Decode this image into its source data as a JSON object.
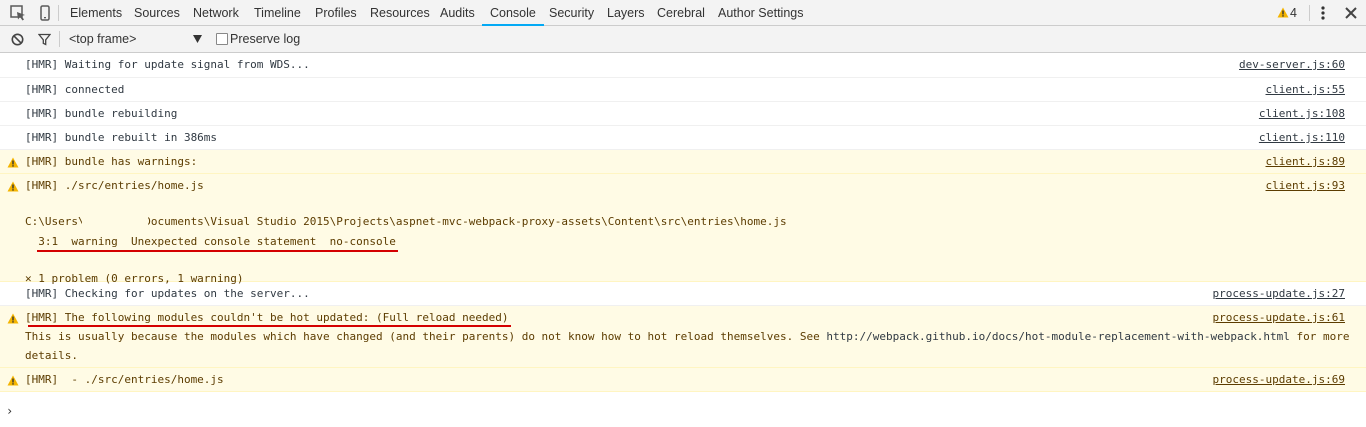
{
  "tabs": [
    "Elements",
    "Sources",
    "Network",
    "Timeline",
    "Profiles",
    "Resources",
    "Audits",
    "Console",
    "Security",
    "Layers",
    "Cerebral",
    "Author Settings"
  ],
  "active_tab": "Console",
  "warning_count": "4",
  "toolbar": {
    "frame": "<top frame>",
    "preserve_log": "Preserve log"
  },
  "messages": {
    "m1": {
      "text": "[HMR] Waiting for update signal from WDS...",
      "src": "dev-server.js:60"
    },
    "m2": {
      "text": "[HMR] connected",
      "src": "client.js:55"
    },
    "m3": {
      "text": "[HMR] bundle rebuilding",
      "src": "client.js:108"
    },
    "m4": {
      "text": "[HMR] bundle rebuilt in 386ms",
      "src": "client.js:110"
    },
    "m5": {
      "text": "[HMR] bundle has warnings:",
      "src": "client.js:89"
    },
    "m6": {
      "text": "[HMR] ./src/entries/home.js",
      "src": "client.js:93",
      "path": "C:\\Users\\        \\Documents\\Visual Studio 2015\\Projects\\aspnet-mvc-webpack-proxy-assets\\Content\\src\\entries\\home.js",
      "detail": "  3:1  warning  Unexpected console statement  no-console",
      "summary": "✕ 1 problem (0 errors, 1 warning)"
    },
    "m7": {
      "text": "[HMR] Checking for updates on the server...",
      "src": "process-update.js:27"
    },
    "m8": {
      "text": "[HMR] The following modules couldn't be hot updated: (Full reload needed)",
      "src": "process-update.js:61",
      "line2": "This is usually because the modules which have changed (and their parents) do not know how to hot reload themselves. See ",
      "link": "http://webpack.github.io/docs/hot-module-replacement-with-webpack.html",
      "line2_end": " for more",
      "line3": "details."
    },
    "m9": {
      "text": "[HMR]  - ./src/entries/home.js",
      "src": "process-update.js:69"
    }
  },
  "prompt": "›",
  "colors": {
    "accent": "#03a9f4",
    "warning_bg": "#fffbe5",
    "warning_icon": "#f4b400",
    "underline": "#d40000"
  }
}
